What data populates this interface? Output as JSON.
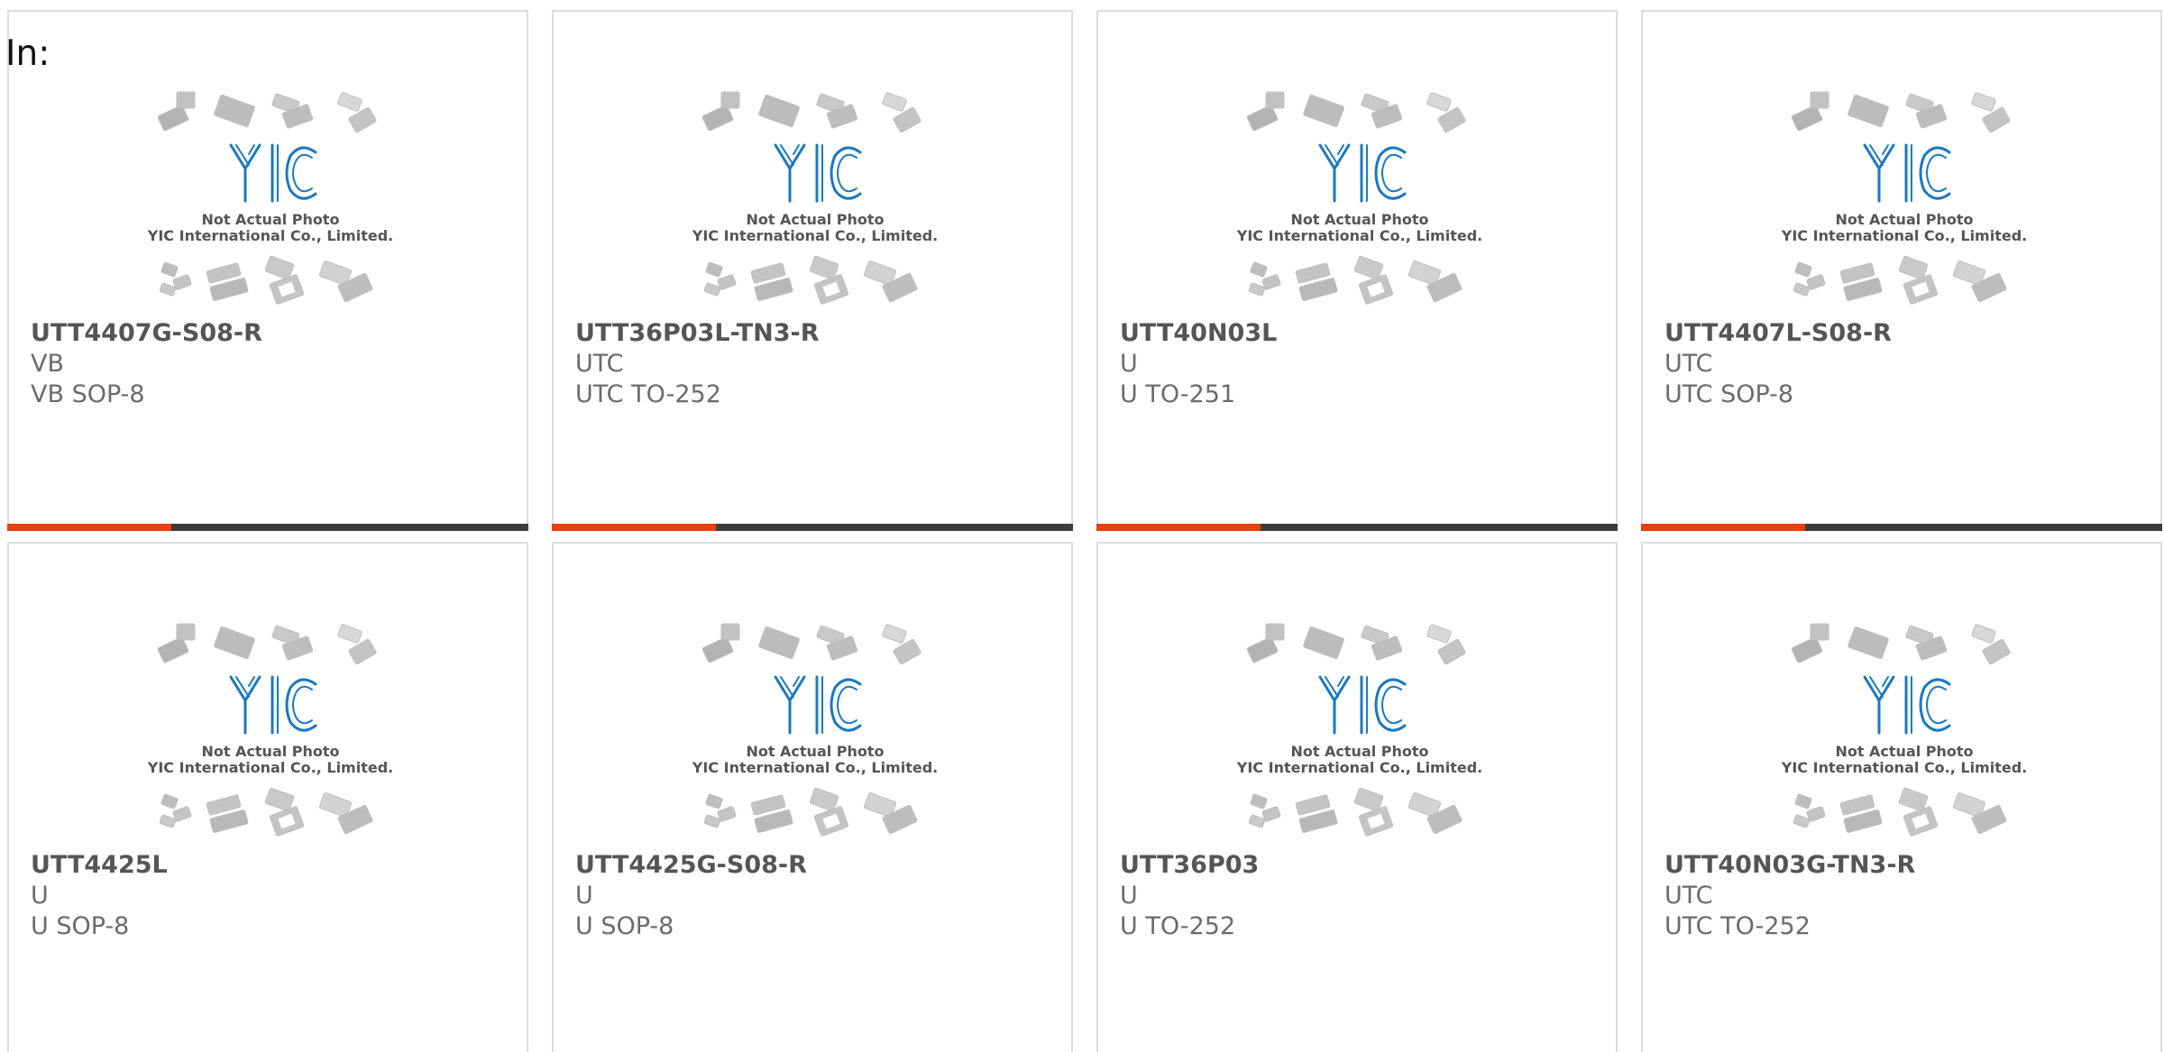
{
  "header": {
    "label": "In:"
  },
  "placeholder_image": {
    "brand": "YIC",
    "line1": "Not Actual Photo",
    "line2": "YIC International Co., Limited."
  },
  "colors": {
    "accent": "#e8400f",
    "bar": "#3c3c3c",
    "logo_blue": "#1a78c2"
  },
  "products": [
    {
      "part": "UTT4407G-S08-R",
      "manufacturer": "VB",
      "package": "VB SOP-8"
    },
    {
      "part": "UTT36P03L-TN3-R",
      "manufacturer": "UTC",
      "package": "UTC TO-252"
    },
    {
      "part": "UTT40N03L",
      "manufacturer": "U",
      "package": "U TO-251"
    },
    {
      "part": "UTT4407L-S08-R",
      "manufacturer": "UTC",
      "package": "UTC SOP-8"
    },
    {
      "part": "UTT4425L",
      "manufacturer": "U",
      "package": "U SOP-8"
    },
    {
      "part": "UTT4425G-S08-R",
      "manufacturer": "U",
      "package": "U SOP-8"
    },
    {
      "part": "UTT36P03",
      "manufacturer": "U",
      "package": "U TO-252"
    },
    {
      "part": "UTT40N03G-TN3-R",
      "manufacturer": "UTC",
      "package": "UTC TO-252"
    }
  ]
}
